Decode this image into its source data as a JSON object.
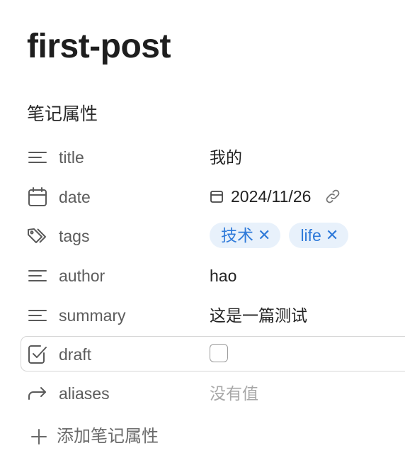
{
  "note": {
    "title": "first-post"
  },
  "properties": {
    "heading": "笔记属性",
    "add_label": "添加笔记属性",
    "rows": [
      {
        "key": "title",
        "icon": "text-lines-icon",
        "value": "我的"
      },
      {
        "key": "date",
        "icon": "calendar-icon",
        "value": "2024/11/26"
      },
      {
        "key": "tags",
        "icon": "tags-icon",
        "tags": [
          "技术",
          "life"
        ]
      },
      {
        "key": "author",
        "icon": "text-lines-icon",
        "value": "hao"
      },
      {
        "key": "summary",
        "icon": "text-lines-icon",
        "value": "这是一篇测试"
      },
      {
        "key": "draft",
        "icon": "checkbox-icon",
        "checked": false
      },
      {
        "key": "aliases",
        "icon": "forward-arrow-icon",
        "value": "没有值"
      }
    ]
  },
  "colors": {
    "tag_bg": "#e8f1fb",
    "tag_text": "#2f7ad9",
    "muted_text": "#5c5c5c",
    "placeholder_text": "#a8a8a8"
  }
}
